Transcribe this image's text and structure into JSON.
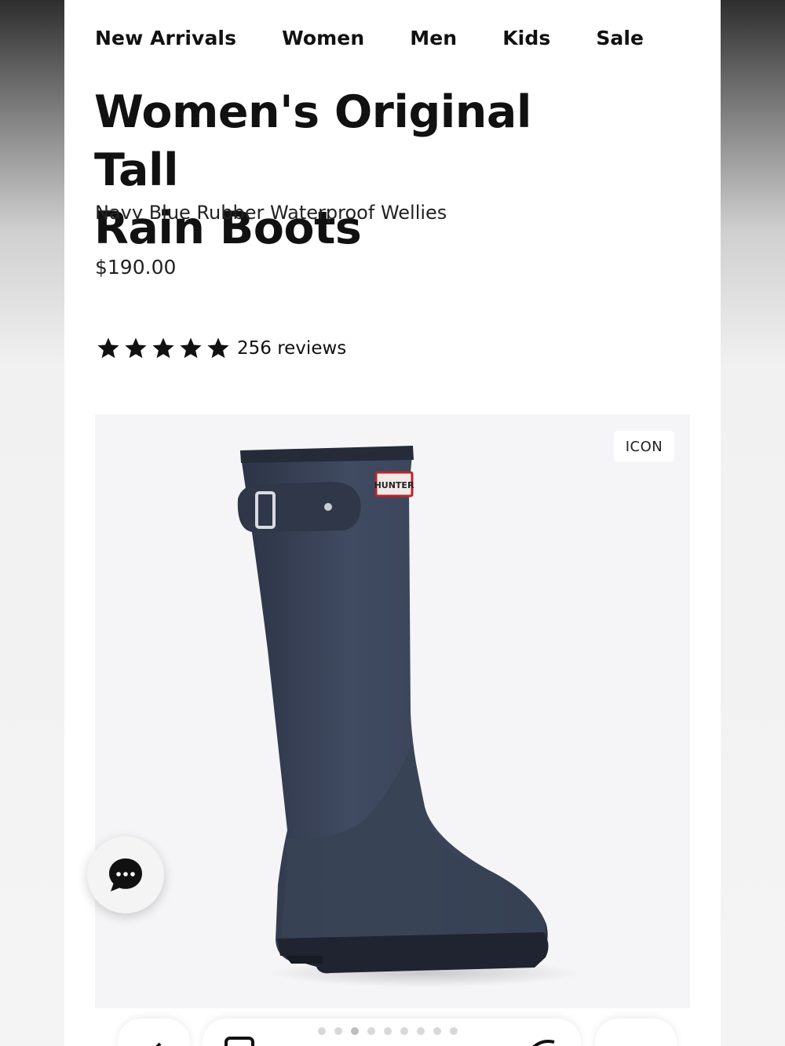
{
  "nav": {
    "items": [
      "New Arrivals",
      "Women",
      "Men",
      "Kids",
      "Sale"
    ]
  },
  "product": {
    "title_line1": "Women's Original Tall",
    "title_line2": "Rain Boots",
    "subtitle": "Navy Blue Rubber Waterproof Wellies",
    "price": "$190.00",
    "rating": 5,
    "rating_max": 5,
    "reviews": "256 reviews",
    "badge": "ICON",
    "brand_tag": "HUNTER",
    "image_description_icon": "rain-boot-image"
  },
  "carousel": {
    "count": 9,
    "active_index": 2
  },
  "colors": {
    "boot": "#3a4256",
    "text": "#111111",
    "panel": "#f5f5f7"
  },
  "icons": {
    "chat": "chat-bubble-icon",
    "back": "chevron-left-icon",
    "share": "share-arrow-icon"
  }
}
